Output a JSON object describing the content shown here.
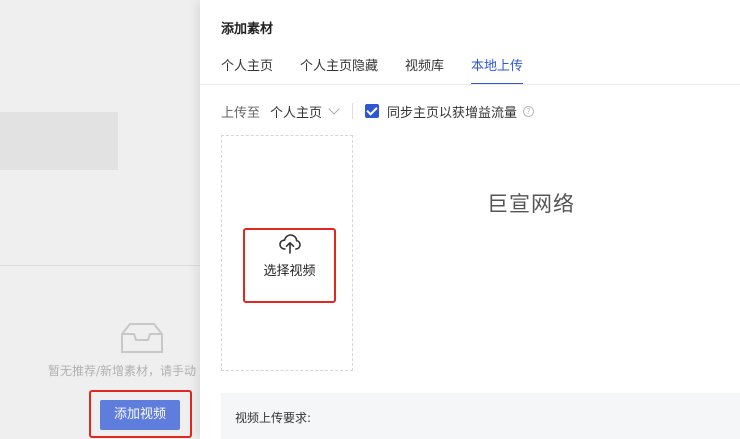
{
  "background": {
    "empty_text": "暂无推荐/新增素材，请手动",
    "add_video_button": "添加视频"
  },
  "drawer": {
    "title": "添加素材",
    "tabs": [
      {
        "label": "个人主页",
        "active": false
      },
      {
        "label": "个人主页隐藏",
        "active": false
      },
      {
        "label": "视频库",
        "active": false
      },
      {
        "label": "本地上传",
        "active": true
      }
    ],
    "upload_to_label": "上传至",
    "upload_to_value": "个人主页",
    "sync_checkbox_label": "同步主页以获增益流量",
    "sync_checked": true,
    "upload_box_label": "选择视频",
    "watermark": "巨宣网络",
    "requirements_title": "视频上传要求:"
  },
  "colors": {
    "accent": "#2e57d6",
    "highlight_outline": "#e0281f"
  },
  "icons": [
    "inbox-empty-icon",
    "chevron-down-icon",
    "checkbox-checked-icon",
    "help-icon",
    "cloud-upload-icon"
  ]
}
